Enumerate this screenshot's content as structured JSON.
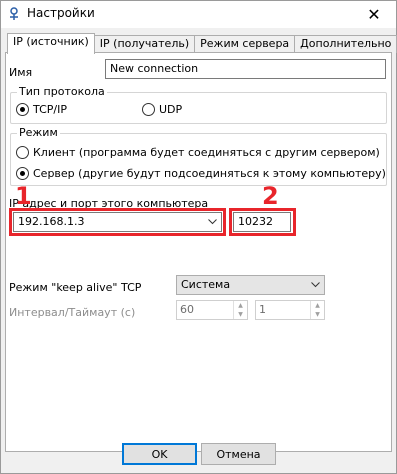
{
  "window": {
    "title": "Настройки",
    "close_glyph": "✕"
  },
  "tabs": [
    {
      "label": "IP (источник)",
      "active": true
    },
    {
      "label": "IP (получатель)",
      "active": false
    },
    {
      "label": "Режим сервера",
      "active": false
    },
    {
      "label": "Дополнительно",
      "active": false
    }
  ],
  "name": {
    "label": "Имя",
    "value": "New connection"
  },
  "protocol": {
    "group_title": "Тип протокола",
    "options": [
      {
        "label": "TCP/IP",
        "selected": true
      },
      {
        "label": "UDP",
        "selected": false
      }
    ]
  },
  "mode": {
    "group_title": "Режим",
    "options": [
      {
        "label": "Клиент (программа будет соединяться с другим сервером)",
        "selected": false
      },
      {
        "label": "Сервер (другие будут подсоединяться к этому компьютеру)",
        "selected": true
      }
    ]
  },
  "address": {
    "label": "IP адрес и порт этого компьютера",
    "ip_value": "192.168.1.3",
    "port_value": "10232"
  },
  "annotations": {
    "marker1": "1",
    "marker2": "2",
    "color": "#e8252b"
  },
  "keepalive": {
    "label": "Режим \"keep alive\" TCP",
    "value": "Система",
    "interval_label": "Интервал/Таймаут (с)",
    "interval_value": "60",
    "timeout_value": "1"
  },
  "buttons": {
    "ok": "OK",
    "cancel": "Отмена"
  }
}
